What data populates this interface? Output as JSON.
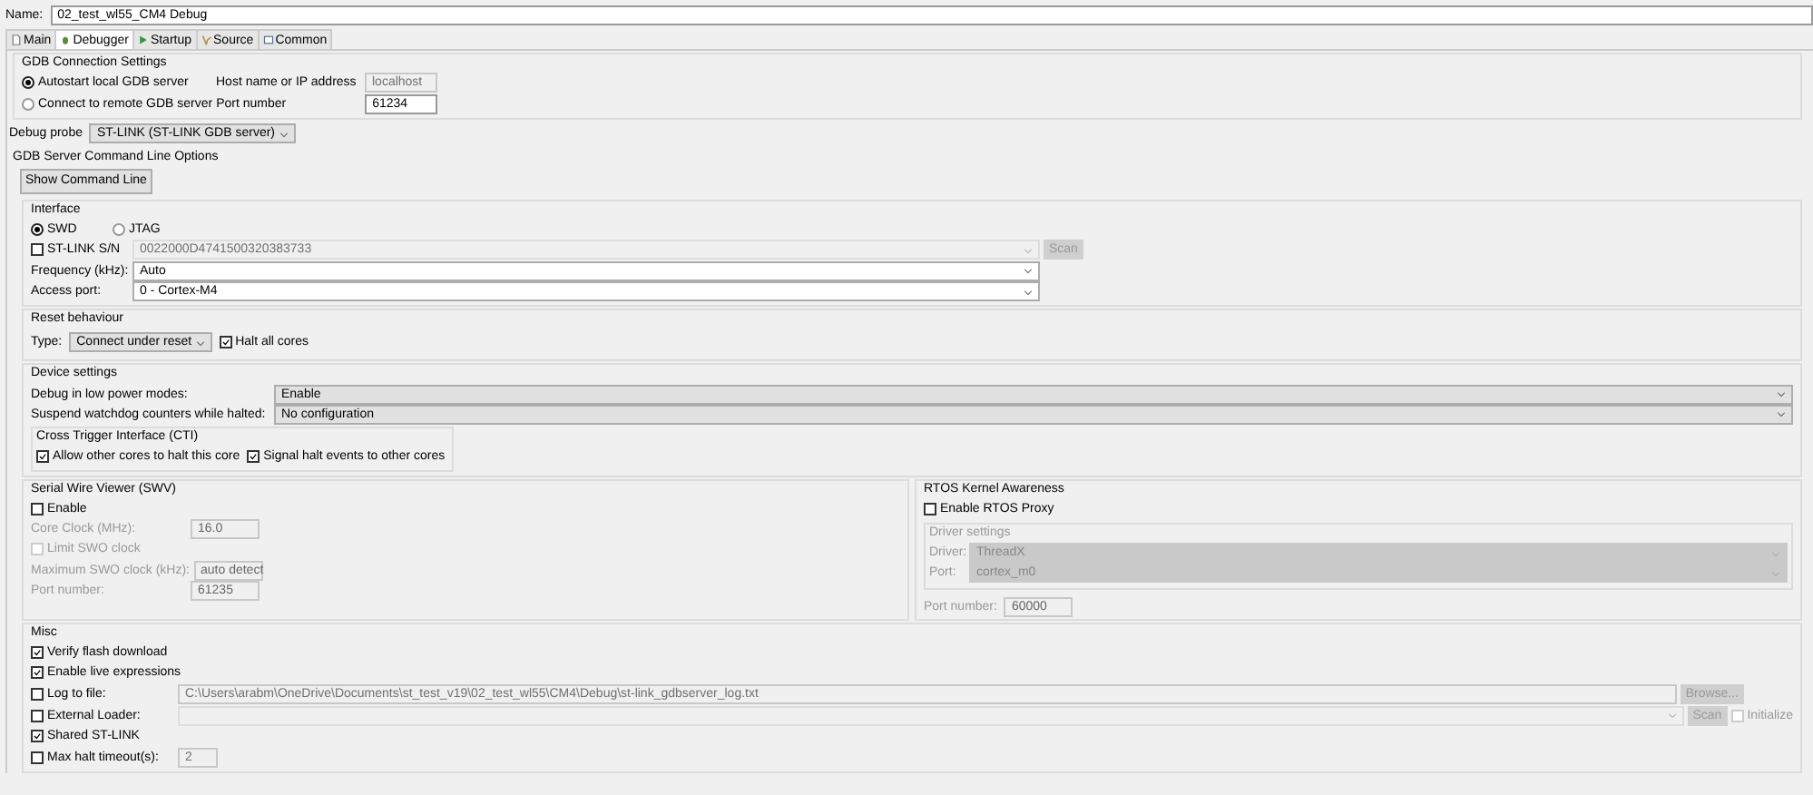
{
  "name": {
    "label": "Name:",
    "value": "02_test_wl55_CM4 Debug"
  },
  "tabs": [
    {
      "label": "Main",
      "selected": false
    },
    {
      "label": "Debugger",
      "selected": true
    },
    {
      "label": "Startup",
      "selected": false
    },
    {
      "label": "Source",
      "selected": false
    },
    {
      "label": "Common",
      "selected": false
    }
  ],
  "gdb_connection": {
    "title": "GDB Connection Settings",
    "modes": [
      {
        "label": "Autostart local GDB server",
        "selected": true
      },
      {
        "label": "Connect to remote GDB server",
        "selected": false
      }
    ],
    "host": {
      "label": "Host name or IP address",
      "value": "localhost"
    },
    "port": {
      "label": "Port number",
      "value": "61234"
    }
  },
  "debug_probe": {
    "label": "Debug probe",
    "value": "ST-LINK (ST-LINK GDB server)"
  },
  "server_options": {
    "title": "GDB Server Command Line Options",
    "button": "Show Command Line"
  },
  "interface": {
    "title": "Interface",
    "protocols": [
      {
        "label": "SWD",
        "selected": true
      },
      {
        "label": "JTAG",
        "selected": false
      }
    ],
    "serial": {
      "label": "ST-LINK S/N",
      "checked": false,
      "value": "0022000D4741500320383733",
      "button": "Scan"
    },
    "frequency": {
      "label": "Frequency (kHz):",
      "value": "Auto"
    },
    "access_port": {
      "label": "Access port:",
      "value": "0 - Cortex-M4"
    }
  },
  "reset": {
    "title": "Reset behaviour",
    "type_label": "Type:",
    "type_value": "Connect under reset",
    "halt_all": {
      "label": "Halt all cores",
      "checked": true
    }
  },
  "device": {
    "title": "Device settings",
    "rows": [
      {
        "label": "Debug in low power modes:",
        "value": "Enable"
      },
      {
        "label": "Suspend watchdog counters while halted:",
        "value": "No configuration"
      }
    ],
    "cti": {
      "title": "Cross Trigger Interface (CTI)",
      "options": [
        {
          "label": "Allow other cores to halt this core",
          "checked": true
        },
        {
          "label": "Signal halt events to other cores",
          "checked": true
        }
      ]
    }
  },
  "swv": {
    "title": "Serial Wire Viewer (SWV)",
    "enable": {
      "label": "Enable",
      "checked": false
    },
    "core_clock": {
      "label": "Core Clock (MHz):",
      "value": "16.0"
    },
    "limit": {
      "label": "Limit SWO clock",
      "checked": false
    },
    "max_clock": {
      "label": "Maximum SWO clock (kHz):",
      "value": "auto detect"
    },
    "port": {
      "label": "Port number:",
      "value": "61235"
    }
  },
  "rtos": {
    "title": "RTOS Kernel Awareness",
    "enable": {
      "label": "Enable RTOS Proxy",
      "checked": false
    },
    "driver_settings": {
      "title": "Driver settings",
      "driver": {
        "label": "Driver:",
        "value": "ThreadX"
      },
      "port": {
        "label": "Port:",
        "value": "cortex_m0"
      }
    },
    "port_number": {
      "label": "Port number:",
      "value": "60000"
    }
  },
  "misc": {
    "title": "Misc",
    "items": [
      {
        "kind": "check",
        "label": "Verify flash download",
        "checked": true
      },
      {
        "kind": "check",
        "label": "Enable live expressions",
        "checked": true
      },
      {
        "kind": "path",
        "label": "Log to file:",
        "checked": false,
        "value": "C:\\Users\\arabm\\OneDrive\\Documents\\st_test_v19\\02_test_wl55\\CM4\\Debug\\st-link_gdbserver_log.txt",
        "button": "Browse..."
      },
      {
        "kind": "loader",
        "label": "External Loader:",
        "checked": false,
        "button": "Scan",
        "option": {
          "label": "Initialize",
          "checked": false
        }
      },
      {
        "kind": "check",
        "label": "Shared ST-LINK",
        "checked": true
      },
      {
        "kind": "number",
        "label": "Max halt timeout(s):",
        "checked": false,
        "value": "2"
      }
    ]
  }
}
